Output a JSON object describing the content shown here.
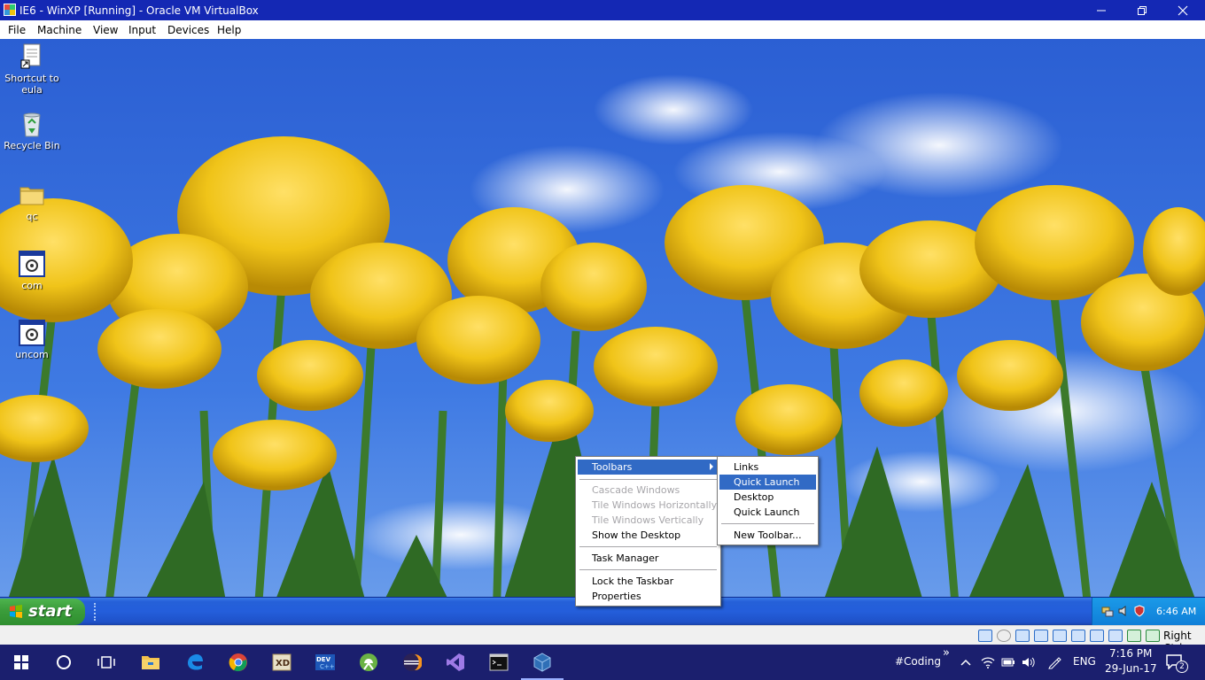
{
  "host_window": {
    "title": "IE6 - WinXP [Running] - Oracle VM VirtualBox",
    "controls": [
      "minimize",
      "restore",
      "close"
    ],
    "menu": [
      "File",
      "Machine",
      "View",
      "Input",
      "Devices",
      "Help"
    ]
  },
  "desktop": {
    "icons": [
      {
        "label": "Shortcut to eula",
        "line1": "Shortcut to",
        "line2": "eula",
        "icon": "document-shortcut-icon"
      },
      {
        "label": "Recycle Bin",
        "line1": "Recycle Bin",
        "line2": "",
        "icon": "recycle-bin-icon"
      },
      {
        "label": "qc",
        "line1": "qc",
        "line2": "",
        "icon": "folder-icon"
      },
      {
        "label": "com",
        "line1": "com",
        "line2": "",
        "icon": "executable-icon"
      },
      {
        "label": "uncom",
        "line1": "uncom",
        "line2": "",
        "icon": "executable-icon"
      }
    ]
  },
  "xp_taskbar": {
    "start_label": "start",
    "clock": "6:46 AM"
  },
  "context_menu": {
    "items": [
      {
        "label": "Toolbars",
        "state": "highlighted",
        "submenu": true
      },
      {
        "label": "Cascade Windows",
        "state": "disabled"
      },
      {
        "label": "Tile Windows Horizontally",
        "state": "disabled"
      },
      {
        "label": "Tile Windows Vertically",
        "state": "disabled"
      },
      {
        "label": "Show the Desktop",
        "state": "enabled"
      },
      {
        "label": "Task Manager",
        "state": "enabled"
      },
      {
        "label": "Lock the Taskbar",
        "state": "enabled"
      },
      {
        "label": "Properties",
        "state": "enabled"
      }
    ]
  },
  "toolbars_submenu": {
    "items": [
      {
        "label": "Links",
        "state": "enabled"
      },
      {
        "label": "Quick Launch",
        "state": "highlighted"
      },
      {
        "label": "Desktop",
        "state": "enabled"
      },
      {
        "label": "Quick Launch",
        "state": "enabled"
      },
      {
        "label": "New Toolbar...",
        "state": "enabled"
      }
    ]
  },
  "vb_status": {
    "host_key": "Right Ctrl"
  },
  "host_taskbar": {
    "apps": [
      "file-explorer",
      "edge",
      "chrome",
      "adobe-xd",
      "dev-cpp",
      "android-studio",
      "eclipse",
      "visual-studio",
      "command-prompt",
      "virtualbox"
    ],
    "toolbar_label": "#Coding",
    "overflow": "»",
    "language": "ENG",
    "time": "7:16 PM",
    "date": "29-Jun-17",
    "notification_count": "2"
  },
  "colors": {
    "title_bar": "#1428b4",
    "xp_taskbar": "#245edb",
    "start_button": "#3c9e3c",
    "menu_highlight": "#316ac5",
    "host_taskbar": "#1b1f6e",
    "sky": "#2d63d6",
    "tulip": "#f0c419"
  }
}
